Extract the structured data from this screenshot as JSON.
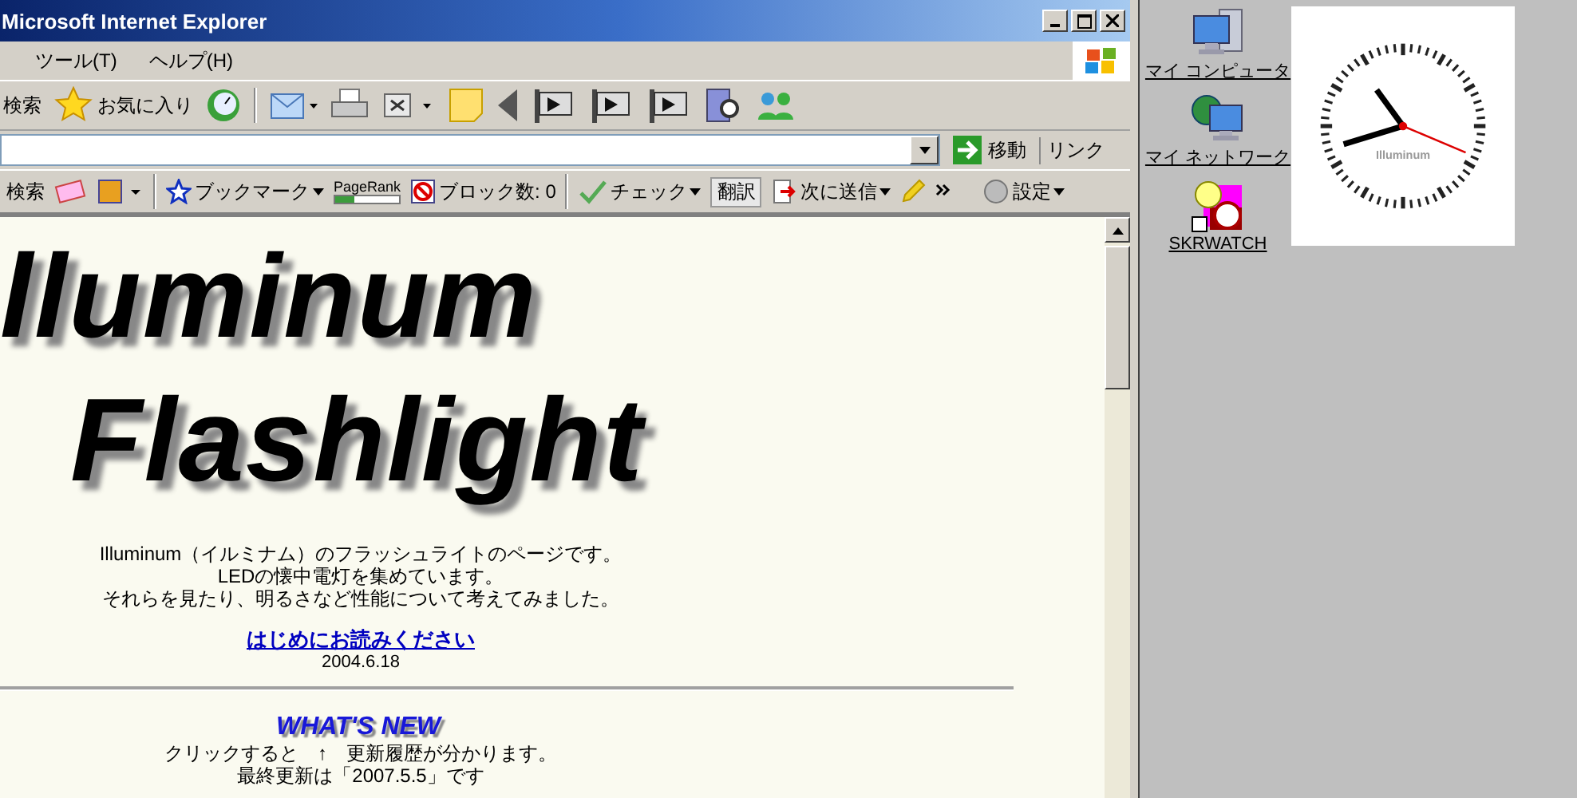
{
  "window": {
    "title": "Microsoft Internet Explorer"
  },
  "menu": [
    "ツール(T)",
    "ヘルプ(H)"
  ],
  "toolbar": {
    "search": "検索",
    "favorites": "お気に入り"
  },
  "address": {
    "go": "移動",
    "links": "リンク"
  },
  "google_toolbar": {
    "search": "検索",
    "bookmarks": "ブックマーク",
    "pagerank_label": "PageRank",
    "pagerank": {
      "level": 0.3
    },
    "blocked": "ブロック数: 0",
    "check": "チェック",
    "translate": "翻訳",
    "send": "次に送信",
    "settings": "設定"
  },
  "page": {
    "heading": [
      "lluminum",
      "Flashlight"
    ],
    "intro": [
      "Illuminum（イルミナム）のフラッシュライトのページです。",
      "LEDの懐中電灯を集めています。",
      "それらを見たり、明るさなど性能について考えてみました。"
    ],
    "link": "はじめにお読みください",
    "date": "2004.6.18",
    "whats_new": "WHAT'S NEW",
    "history": "クリックすると　↑　更新履歴が分かります。",
    "updated": "最終更新は「2007.5.5」です"
  },
  "desktop": {
    "icons": [
      {
        "kind": "computer",
        "label": "マイ コンピュータ"
      },
      {
        "kind": "network",
        "label": "マイ ネットワーク"
      },
      {
        "kind": "watch",
        "label": "SKRWATCH"
      }
    ],
    "clock": {
      "brand": "Illuminum"
    }
  }
}
